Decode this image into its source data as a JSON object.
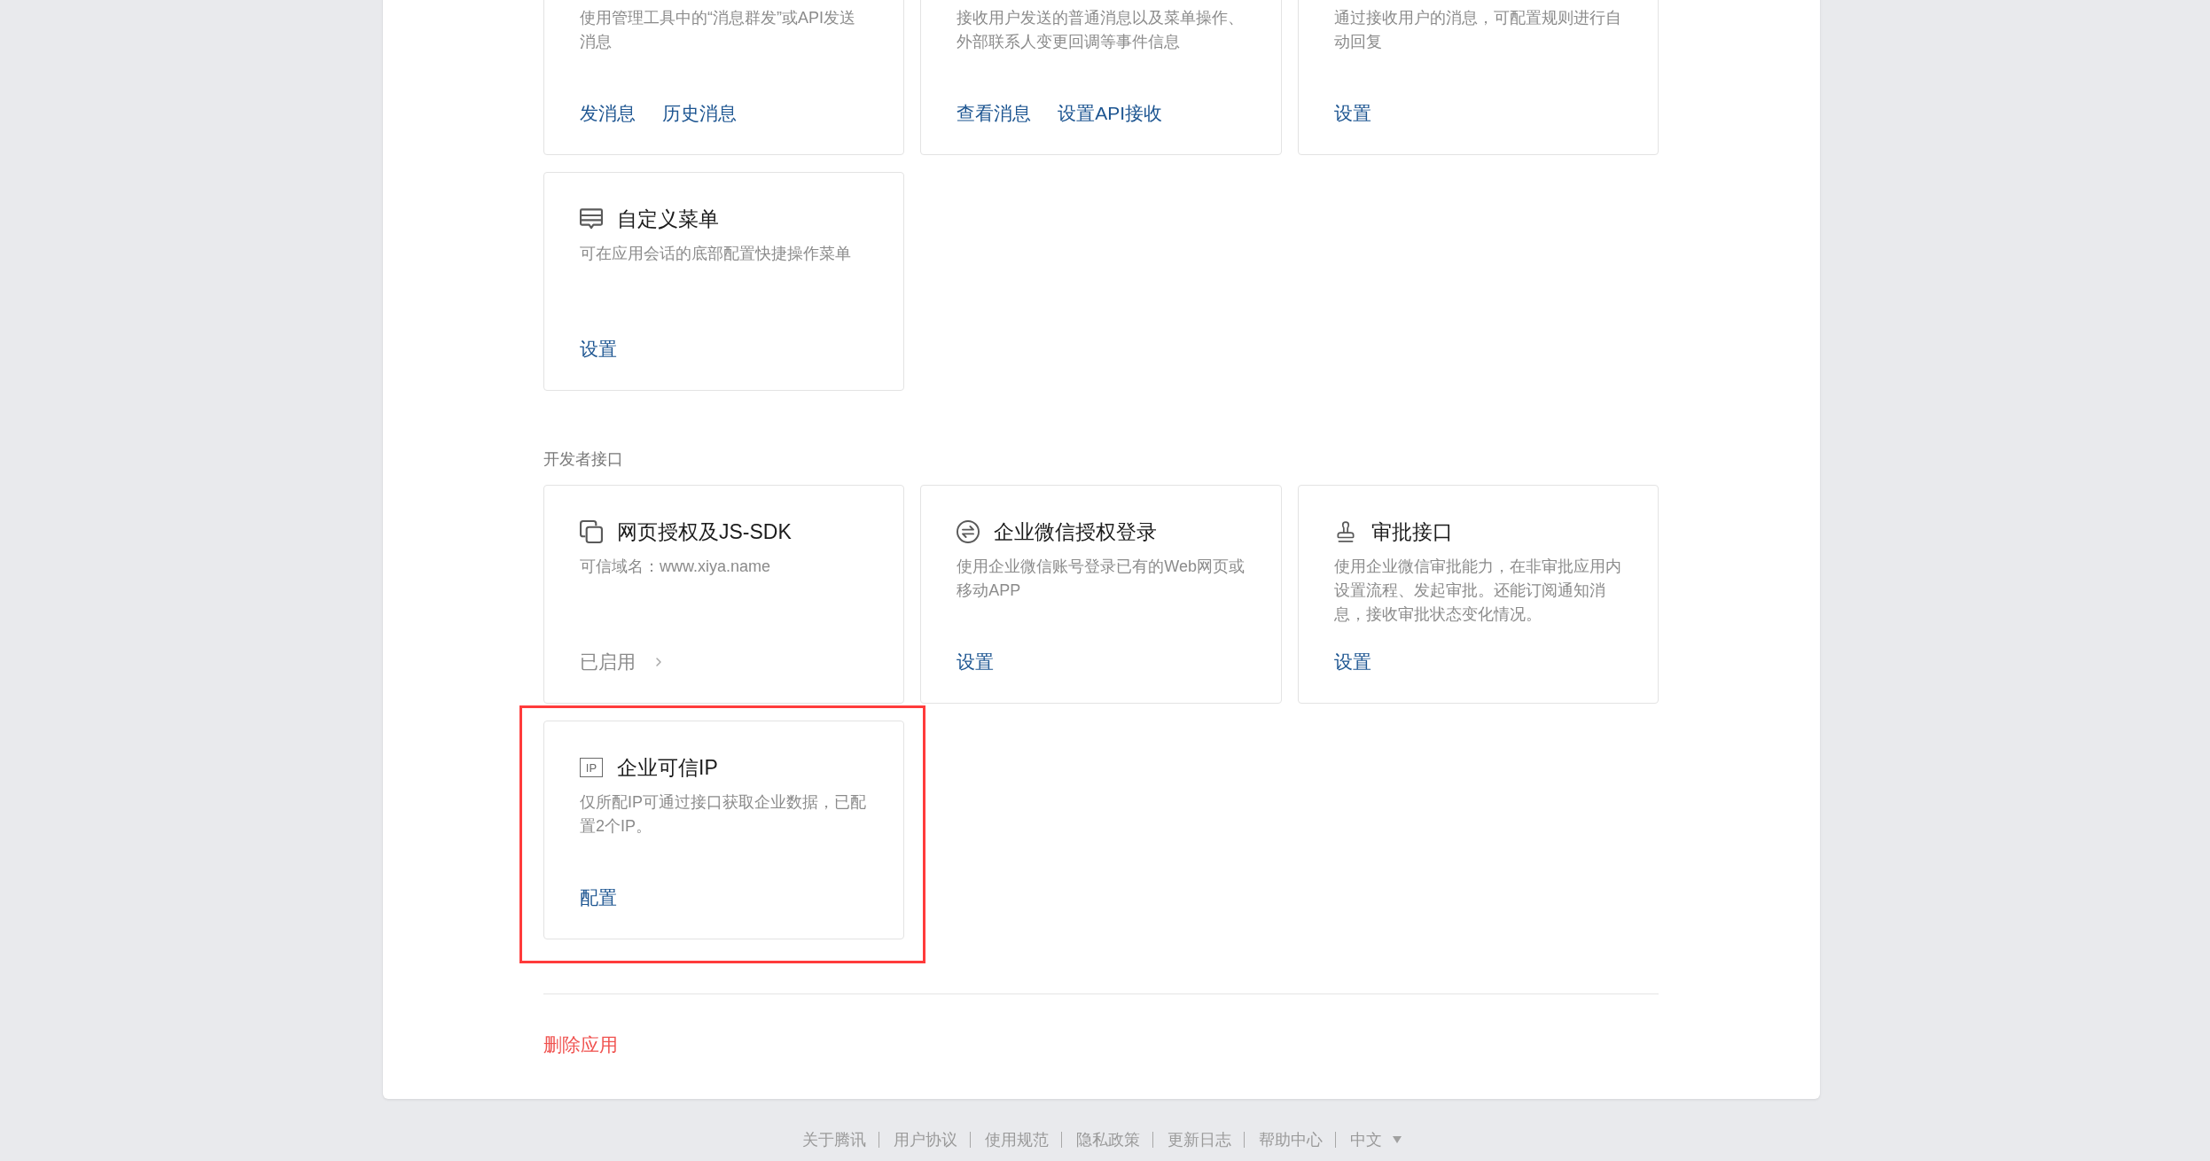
{
  "sections": [
    {
      "cards": [
        {
          "description": "使用管理工具中的“消息群发”或API发送消息",
          "actions": [
            {
              "label": "发消息",
              "kind": "link"
            },
            {
              "label": "历史消息",
              "kind": "link"
            }
          ],
          "highlighted": false
        },
        {
          "description": "接收用户发送的普通消息以及菜单操作、外部联系人变更回调等事件信息",
          "actions": [
            {
              "label": "查看消息",
              "kind": "link"
            },
            {
              "label": "设置API接收",
              "kind": "link"
            }
          ],
          "highlighted": false
        },
        {
          "description": "通过接收用户的消息，可配置规则进行自动回复",
          "actions": [
            {
              "label": "设置",
              "kind": "link"
            }
          ],
          "highlighted": false
        },
        {
          "kind": "menu",
          "title": "自定义菜单",
          "description": "可在应用会话的底部配置快捷操作菜单",
          "actions": [
            {
              "label": "设置",
              "kind": "link"
            }
          ],
          "highlighted": false
        }
      ]
    },
    {
      "label": "开发者接口",
      "cards": [
        {
          "kind": "webpage",
          "title": "网页授权及JS-SDK",
          "description": "可信域名：www.xiya.name",
          "actions": [
            {
              "label": "已启用",
              "kind": "status"
            }
          ],
          "highlighted": false
        },
        {
          "kind": "login",
          "title": "企业微信授权登录",
          "description": "使用企业微信账号登录已有的Web网页或移动APP",
          "actions": [
            {
              "label": "设置",
              "kind": "link"
            }
          ],
          "highlighted": false
        },
        {
          "kind": "approval",
          "title": "审批接口",
          "description": "使用企业微信审批能力，在非审批应用内设置流程、发起审批。还能订阅通知消息，接收审批状态变化情况。",
          "actions": [
            {
              "label": "设置",
              "kind": "link"
            }
          ],
          "highlighted": false
        },
        {
          "kind": "ip",
          "icon_text": "IP",
          "title": "企业可信IP",
          "description": "仅所配IP可通过接口获取企业数据，已配置2个IP。",
          "actions": [
            {
              "label": "配置",
              "kind": "link"
            }
          ],
          "highlighted": true
        }
      ]
    }
  ],
  "delete_action": {
    "label": "删除应用"
  },
  "footer": {
    "links": [
      "关于腾讯",
      "用户协议",
      "使用规范",
      "隐私政策",
      "更新日志",
      "帮助中心"
    ],
    "language": "中文"
  }
}
